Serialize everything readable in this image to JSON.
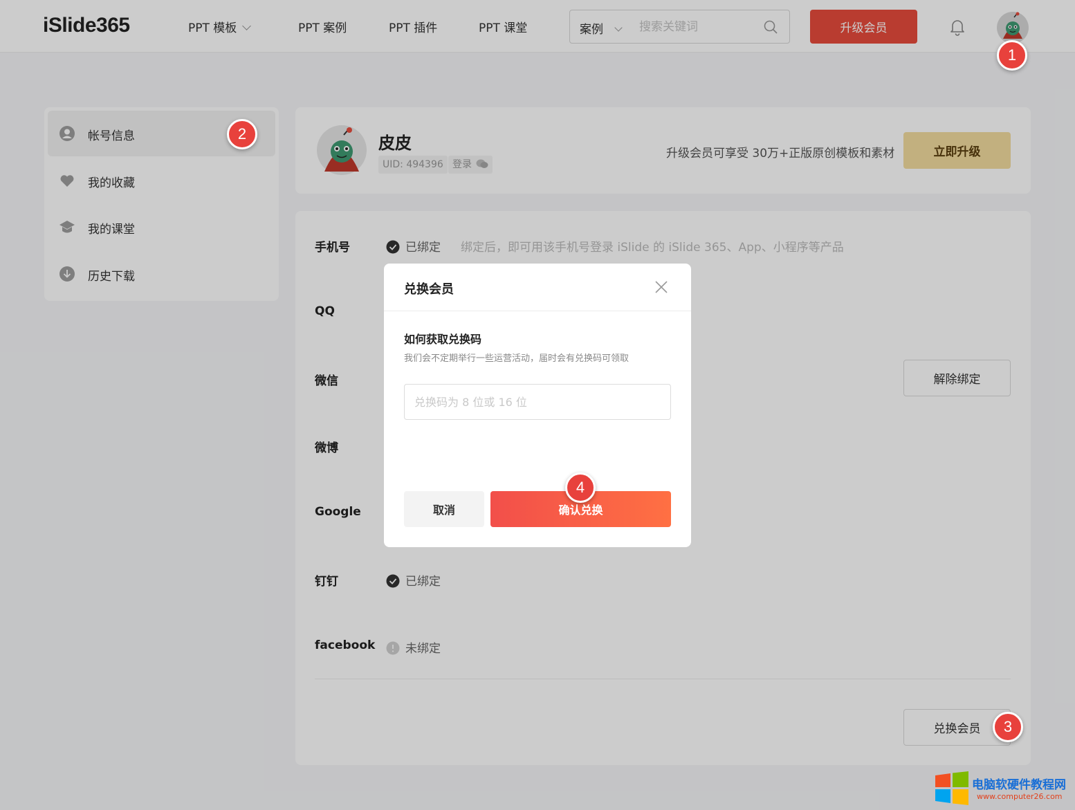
{
  "header": {
    "logo": "iSlide365",
    "nav": [
      {
        "label": "PPT 模板",
        "has_dropdown": true
      },
      {
        "label": "PPT 案例"
      },
      {
        "label": "PPT 插件"
      },
      {
        "label": "PPT 课堂"
      }
    ],
    "search": {
      "category": "案例",
      "placeholder": "搜索关键词"
    },
    "upgrade_label": "升级会员"
  },
  "sidebar": {
    "items": [
      {
        "label": "帐号信息",
        "icon": "user-icon",
        "active": true
      },
      {
        "label": "我的收藏",
        "icon": "heart-icon"
      },
      {
        "label": "我的课堂",
        "icon": "graduation-cap-icon"
      },
      {
        "label": "历史下载",
        "icon": "download-icon"
      }
    ]
  },
  "profile": {
    "name": "皮皮",
    "uid": "UID: 494396",
    "login_tag": "登录",
    "promo": "升级会员可享受 30万+正版原创模板和素材",
    "upgrade_now_label": "立即升级"
  },
  "bindings": {
    "rows": [
      {
        "label": "手机号",
        "status": "已绑定",
        "bound": true,
        "desc": "绑定后，即可用该手机号登录 iSlide 的 iSlide 365、App、小程序等产品"
      },
      {
        "label": "QQ",
        "status": ""
      },
      {
        "label": "微信",
        "status": ""
      },
      {
        "label": "微博",
        "status": ""
      },
      {
        "label": "Google",
        "status": ""
      },
      {
        "label": "钉钉",
        "status": "已绑定",
        "bound": true
      },
      {
        "label": "facebook",
        "status": "未绑定",
        "bound": false
      }
    ],
    "unbind_label": "解除绑定",
    "redeem_label": "兑换会员"
  },
  "modal": {
    "title": "兑换会员",
    "subtitle": "如何获取兑换码",
    "hint": "我们会不定期举行一些运营活动，届时会有兑换码可领取",
    "input_placeholder": "兑换码为 8 位或 16 位",
    "input_value": "",
    "cancel_label": "取消",
    "confirm_label": "确认兑换"
  },
  "steps": [
    "1",
    "2",
    "3",
    "4"
  ],
  "watermark": {
    "title": "电脑软硬件教程网",
    "url": "www.computer26.com"
  },
  "colors": {
    "accent": "#e84c3d",
    "gold": "#f3dc9f",
    "step": "#e8413c",
    "bound": "#333333"
  }
}
